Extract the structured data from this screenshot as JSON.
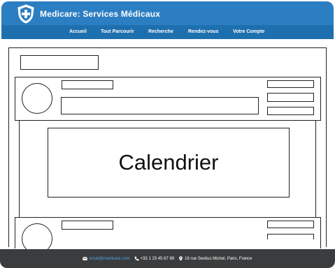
{
  "header": {
    "brand": "Medicare: Services Médicaux",
    "logo_icon": "shield-cross-icon",
    "background": "#2c7ec2"
  },
  "nav": {
    "background": "#1e6fae",
    "items": [
      {
        "label": "Accueil"
      },
      {
        "label": "Tout Parcourir"
      },
      {
        "label": "Recherche"
      },
      {
        "label": "Rendez-vous"
      },
      {
        "label": "Votre Compte"
      }
    ]
  },
  "main": {
    "calendar_label": "Calendrier"
  },
  "footer": {
    "background": "#3b3c3d",
    "email": "email@medicare.com",
    "email_icon": "envelope-icon",
    "phone": "+33 1 23 45 67 89",
    "phone_icon": "phone-icon",
    "address": "16 rue Sextius Michel, Paris, France",
    "address_icon": "map-marker-icon"
  }
}
